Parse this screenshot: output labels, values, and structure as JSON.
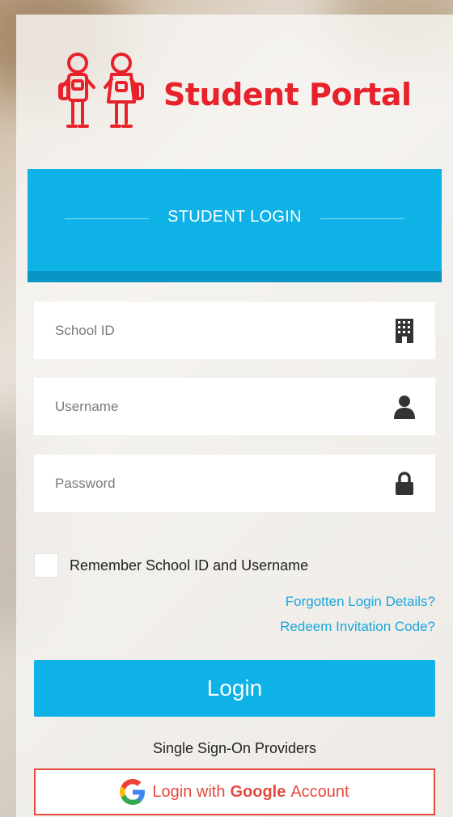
{
  "brand": {
    "name": "Student Portal",
    "color": "#e8212b"
  },
  "banner": {
    "title": "STUDENT LOGIN",
    "color": "#0fb2e6"
  },
  "fields": {
    "school_id": {
      "placeholder": "School ID",
      "icon": "building-icon"
    },
    "username": {
      "placeholder": "Username",
      "icon": "user-icon"
    },
    "password": {
      "placeholder": "Password",
      "icon": "lock-icon"
    }
  },
  "remember": {
    "label": "Remember School ID and Username",
    "checked": false
  },
  "links": {
    "forgot": "Forgotten Login Details?",
    "redeem": "Redeem Invitation Code?"
  },
  "login_button": {
    "label": "Login"
  },
  "sso": {
    "label": "Single Sign-On Providers",
    "google": {
      "prefix": "Login with",
      "provider": "Google",
      "suffix": "Account",
      "color": "#e64a3f"
    }
  }
}
